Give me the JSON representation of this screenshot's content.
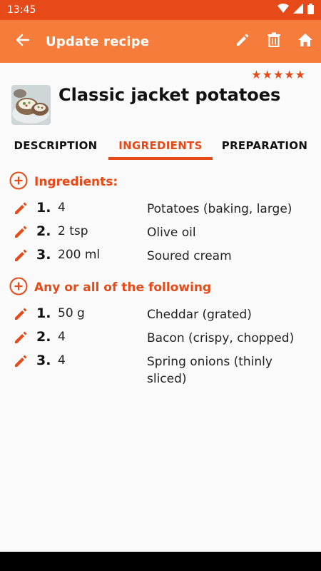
{
  "status_bar": {
    "time": "13:45",
    "icons": [
      "wifi-icon",
      "signal-icon",
      "battery-icon"
    ]
  },
  "app_bar": {
    "title": "Update recipe",
    "icons": [
      "back-arrow-icon",
      "edit-icon",
      "delete-icon",
      "home-icon"
    ]
  },
  "recipe": {
    "title": "Classic jacket potatoes",
    "rating": 5,
    "rating_max": 5
  },
  "tabs": [
    {
      "label": "DESCRIPTION",
      "active": false
    },
    {
      "label": "INGREDIENTS",
      "active": true
    },
    {
      "label": "PREPARATION",
      "active": false
    }
  ],
  "sections": [
    {
      "title": "Ingredients:",
      "items": [
        {
          "num": "1.",
          "qty": "4",
          "name": "Potatoes (baking, large)"
        },
        {
          "num": "2.",
          "qty": "2 tsp",
          "name": "Olive oil"
        },
        {
          "num": "3.",
          "qty": "200 ml",
          "name": "Soured cream"
        }
      ]
    },
    {
      "title": "Any or all of the following",
      "items": [
        {
          "num": "1.",
          "qty": "50 g",
          "name": "Cheddar (grated)"
        },
        {
          "num": "2.",
          "qty": "4",
          "name": "Bacon (crispy, chopped)"
        },
        {
          "num": "3.",
          "qty": "4",
          "name": "Spring onions (thinly sliced)"
        }
      ]
    }
  ],
  "colors": {
    "accent": "#e64a19",
    "app_bar": "#f57c3a",
    "status_bar": "#e64a19"
  }
}
